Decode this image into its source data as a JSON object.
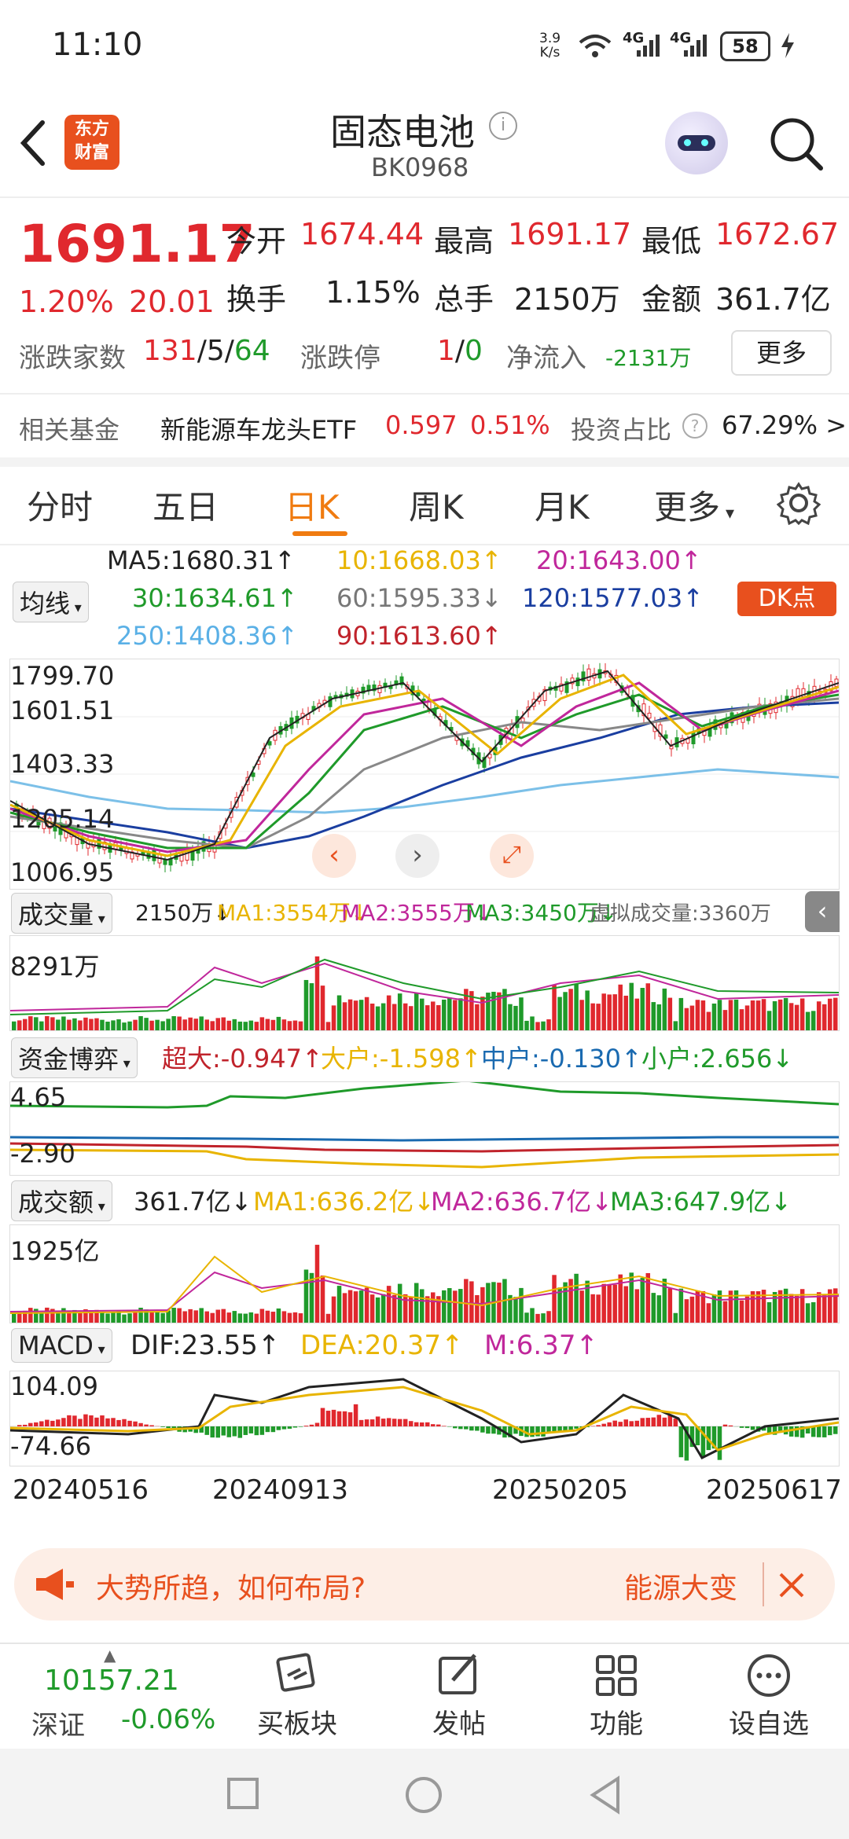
{
  "status": {
    "time": "11:10",
    "speed_top": "3.9",
    "speed_bottom": "K/s",
    "net1": "4G",
    "net2": "4G",
    "battery": "58"
  },
  "header": {
    "title": "固态电池",
    "code": "BK0968",
    "logo_top": "东方",
    "logo_bottom": "财富"
  },
  "quote": {
    "price": "1691.17",
    "pct": "1.20%",
    "chg": "20.01",
    "open_label": "今开",
    "open": "1674.44",
    "high_label": "最高",
    "high": "1691.17",
    "low_label": "最低",
    "low": "1672.67",
    "turnover_label": "换手",
    "turnover": "1.15%",
    "vol_label": "总手",
    "vol": "2150万",
    "amount_label": "金额",
    "amount": "361.7亿",
    "updown_label": "涨跌家数",
    "up": "131",
    "flat": "5",
    "down": "64",
    "limit_label": "涨跌停",
    "limit_up": "1",
    "limit_down": "0",
    "net_label": "净流入",
    "net": "-2131万",
    "more_btn": "更多"
  },
  "fund": {
    "label": "相关基金",
    "name": "新能源车龙头ETF",
    "price": "0.597",
    "pct": "0.51%",
    "ratio_label": "投资占比",
    "ratio": "67.29% >"
  },
  "tabs": {
    "t1": "分时",
    "t2": "五日",
    "t3": "日K",
    "t4": "周K",
    "t5": "月K",
    "t6": "更多"
  },
  "ma": {
    "selector": "均线",
    "ma5": "MA5:1680.31↑",
    "ma10": "10:1668.03↑",
    "ma20": "20:1643.00↑",
    "ma30": "30:1634.61↑",
    "ma60": "60:1595.33↓",
    "ma120": "120:1577.03↑",
    "ma250": "250:1408.36↑",
    "ma90": "90:1613.60↑",
    "dk_btn": "DK点"
  },
  "kline": {
    "y1": "1799.70",
    "y2": "1601.51",
    "y3": "1403.33",
    "y4": "1205.14",
    "y5": "1006.95"
  },
  "volume": {
    "selector": "成交量",
    "v": "2150万↓",
    "ma1": "MA1:3554万↓",
    "ma2": "MA2:3555万↓",
    "ma3": "MA3:3450万↓",
    "virtual": "虚拟成交量:3360万",
    "ymax": "8291万"
  },
  "fundflow": {
    "selector": "资金博弈",
    "c1": "超大:-0.947↑",
    "c2": "大户:-1.598↑",
    "c3": "中户:-0.130↑",
    "c4": "小户:2.656↓",
    "ymax": "4.65",
    "ymin": "-2.90"
  },
  "amount": {
    "selector": "成交额",
    "v": "361.7亿↓",
    "ma1": "MA1:636.2亿↓",
    "ma2": "MA2:636.7亿↓",
    "ma3": "MA3:647.9亿↓",
    "ymax": "1925亿"
  },
  "macd": {
    "selector": "MACD",
    "dif": "DIF:23.55↑",
    "dea": "DEA:20.37↑",
    "m": "M:6.37↑",
    "ymax": "104.09",
    "ymin": "-74.66"
  },
  "dates": {
    "d1": "20240516",
    "d2": "20240913",
    "d3": "20250205",
    "d4": "20250617"
  },
  "banner": {
    "text": "大势所趋，如何布局?",
    "right": "能源大变"
  },
  "bottom": {
    "index_val": "10157.21",
    "index_name": "深证",
    "index_pct": "-0.06%",
    "b1": "买板块",
    "b2": "发帖",
    "b3": "功能",
    "b4": "设自选"
  },
  "colors": {
    "up": "#e0282e",
    "down": "#1f9a2a",
    "accent": "#f07b10",
    "ma5": "#222222",
    "ma10": "#e8b400",
    "ma20": "#c0279b",
    "ma30": "#1f9a2a",
    "ma60": "#888888",
    "ma120": "#1a3ea0",
    "ma250": "#7cc0e8",
    "ma90": "#c0232b"
  }
}
